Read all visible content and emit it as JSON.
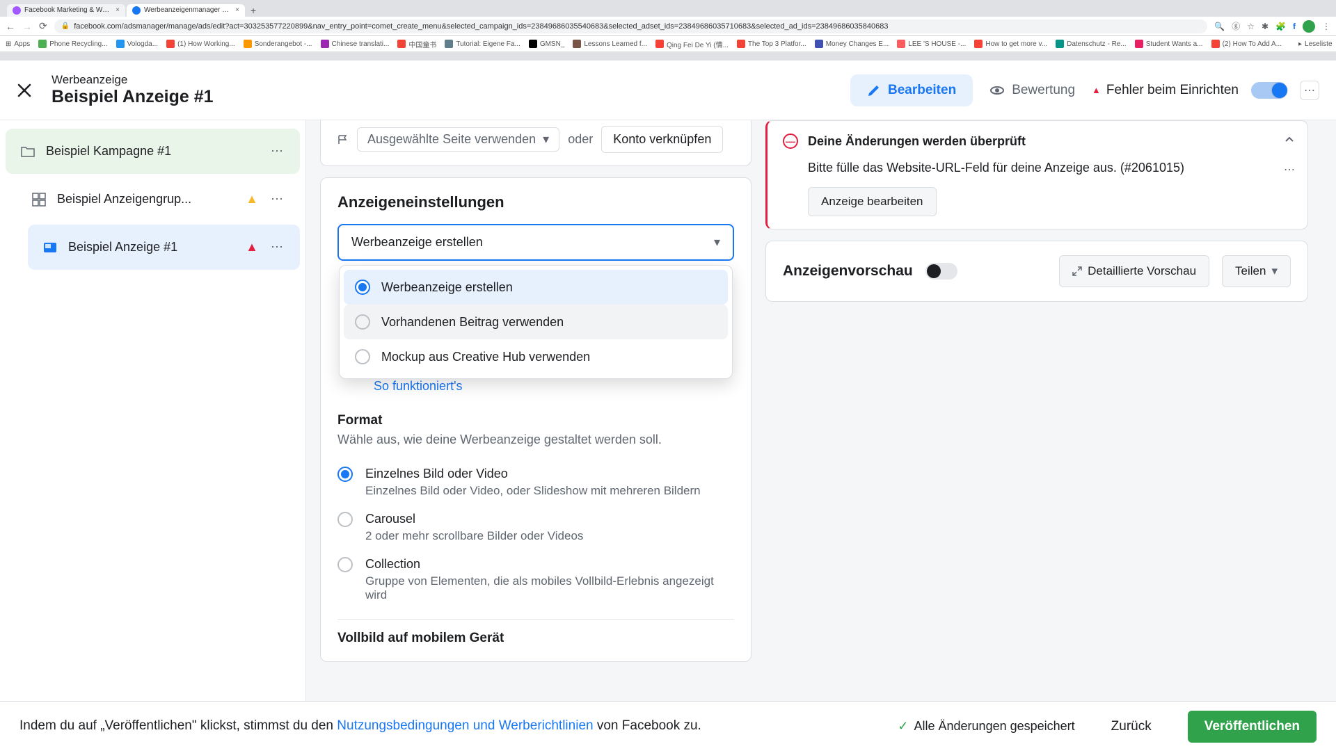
{
  "browser": {
    "tabs": [
      {
        "title": "Facebook Marketing & Werbea...",
        "active": false
      },
      {
        "title": "Werbeanzeigenmanager – We...",
        "active": true
      }
    ],
    "url": "facebook.com/adsmanager/manage/ads/edit?act=303253577220899&nav_entry_point=comet_create_menu&selected_campaign_ids=23849686035540683&selected_adset_ids=23849686035710683&selected_ad_ids=23849686035840683",
    "bookmarks": [
      "Apps",
      "Phone Recycling...",
      "Vologda...",
      "(1) How Working...",
      "Sonderangebot -...",
      "Chinese translati...",
      "中国童书",
      "Tutorial: Eigene Fa...",
      "GMSN_",
      "Lessons Learned f...",
      "Qing Fei De Yi (情...",
      "The Top 3 Platfor...",
      "Money Changes E...",
      "LEE 'S HOUSE -...",
      "How to get more v...",
      "Datenschutz - Re...",
      "Student Wants a...",
      "(2) How To Add A...",
      "Leseliste"
    ]
  },
  "header": {
    "subtitle": "Werbeanzeige",
    "title": "Beispiel Anzeige #1",
    "tab_edit": "Bearbeiten",
    "tab_review": "Bewertung",
    "error_status": "Fehler beim Einrichten"
  },
  "sidebar": {
    "campaign": "Beispiel Kampagne #1",
    "adgroup": "Beispiel Anzeigengrup...",
    "ad": "Beispiel Anzeige #1"
  },
  "center": {
    "page_selector": "Ausgewählte Seite verwenden",
    "oder": "oder",
    "link_account": "Konto verknüpfen",
    "settings_title": "Anzeigeneinstellungen",
    "select_value": "Werbeanzeige erstellen",
    "options": [
      "Werbeanzeige erstellen",
      "Vorhandenen Beitrag verwenden",
      "Mockup aus Creative Hub verwenden"
    ],
    "help_link": "So funktioniert's",
    "format_title": "Format",
    "format_desc": "Wähle aus, wie deine Werbeanzeige gestaltet werden soll.",
    "formats": [
      {
        "label": "Einzelnes Bild oder Video",
        "hint": "Einzelnes Bild oder Video, oder Slideshow mit mehreren Bildern"
      },
      {
        "label": "Carousel",
        "hint": "2 oder mehr scrollbare Bilder oder Videos"
      },
      {
        "label": "Collection",
        "hint": "Gruppe von Elementen, die als mobiles Vollbild-Erlebnis angezeigt wird"
      }
    ],
    "next_section": "Vollbild auf mobilem Gerät"
  },
  "right": {
    "banner_title": "Deine Änderungen werden überprüft",
    "banner_body": "Bitte fülle das Website-URL-Feld für deine Anzeige aus. (#2061015)",
    "banner_btn": "Anzeige bearbeiten",
    "preview_title": "Anzeigenvorschau",
    "detail_btn": "Detaillierte Vorschau",
    "share_btn": "Teilen"
  },
  "footer": {
    "text_prefix": "Indem du auf „Veröffentlichen\" klickst, stimmst du den ",
    "text_link": "Nutzungsbedingungen und Werberichtlinien",
    "text_suffix": " von Facebook zu.",
    "saved": "Alle Änderungen gespeichert",
    "back": "Zurück",
    "publish": "Veröffentlichen"
  }
}
